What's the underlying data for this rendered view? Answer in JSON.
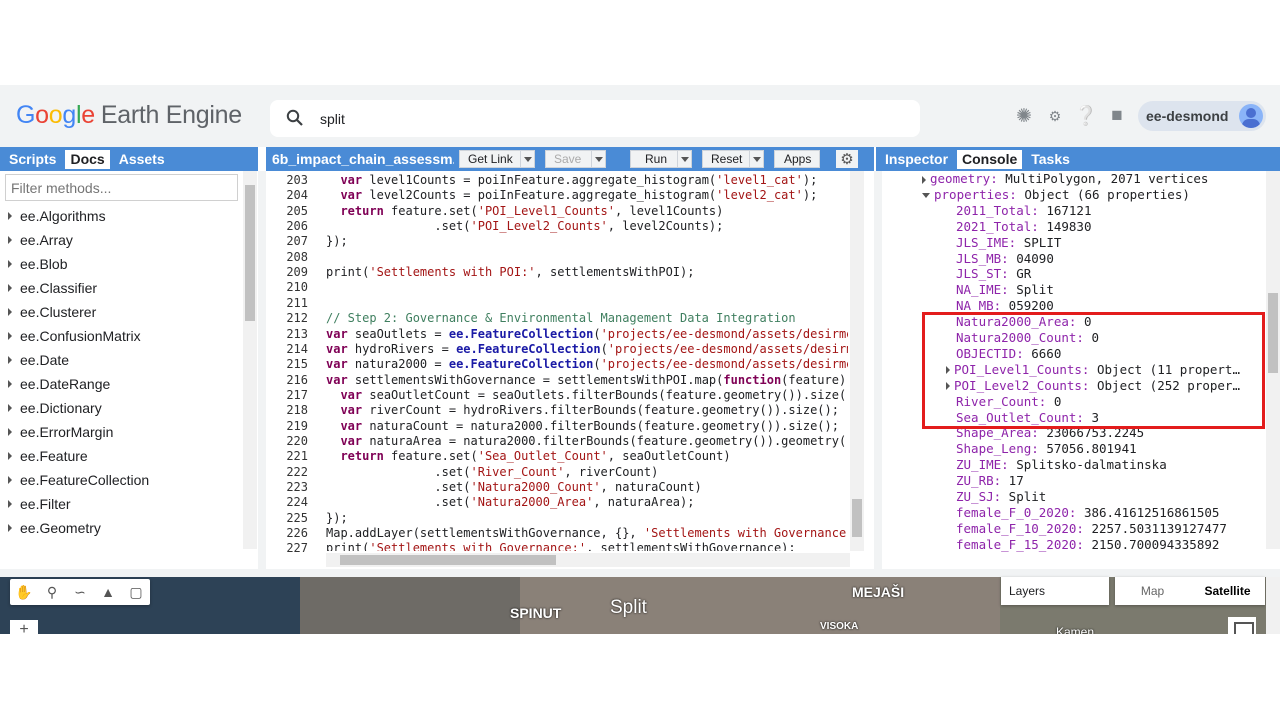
{
  "header": {
    "logo": {
      "g1": "G",
      "g2": "o",
      "g3": "o",
      "g4": "g",
      "g5": "l",
      "g6": "e",
      "rest": "Earth Engine"
    },
    "search_value": "split",
    "user": "ee-desmond",
    "icons": [
      "brightness-icon",
      "apps-icon",
      "help-icon",
      "feedback-icon"
    ]
  },
  "left_tabs": [
    "Scripts",
    "Docs",
    "Assets"
  ],
  "left_active": "Docs",
  "filter_placeholder": "Filter methods...",
  "doc_items": [
    "ee.Algorithms",
    "ee.Array",
    "ee.Blob",
    "ee.Classifier",
    "ee.Clusterer",
    "ee.ConfusionMatrix",
    "ee.Date",
    "ee.DateRange",
    "ee.Dictionary",
    "ee.ErrorMargin",
    "ee.Feature",
    "ee.FeatureCollection",
    "ee.Filter",
    "ee.Geometry"
  ],
  "editor": {
    "script_name": "6b_impact_chain_assessm...",
    "buttons": {
      "get_link": "Get Link",
      "save": "Save",
      "run": "Run",
      "reset": "Reset",
      "apps": "Apps"
    },
    "line_numbers": [
      "203",
      "204",
      "205",
      "206",
      "207",
      "208",
      "209",
      "210",
      "211",
      "212",
      "213",
      "214",
      "215",
      "216",
      "217",
      "218",
      "219",
      "220",
      "221",
      "222",
      "223",
      "224",
      "225",
      "226",
      "227"
    ],
    "lines": [
      "  var level1Counts = poiInFeature.aggregate_histogram('level1_cat');",
      "  var level2Counts = poiInFeature.aggregate_histogram('level2_cat');",
      "  return feature.set('POI_Level1_Counts', level1Counts)",
      "               .set('POI_Level2_Counts', level2Counts);",
      "});",
      "",
      "print('Settlements with POI:', settlementsWithPOI);",
      "",
      "",
      "// Step 2: Governance & Environmental Management Data Integration",
      "var seaOutlets = ee.FeatureCollection('projects/ee-desmond/assets/desirme",
      "var hydroRivers = ee.FeatureCollection('projects/ee-desmond/assets/desirm",
      "var natura2000 = ee.FeatureCollection('projects/ee-desmond/assets/desirme",
      "var settlementsWithGovernance = settlementsWithPOI.map(function(feature)",
      "  var seaOutletCount = seaOutlets.filterBounds(feature.geometry()).size()",
      "  var riverCount = hydroRivers.filterBounds(feature.geometry()).size();",
      "  var naturaCount = natura2000.filterBounds(feature.geometry()).size();",
      "  var naturaArea = natura2000.filterBounds(feature.geometry()).geometry()",
      "  return feature.set('Sea_Outlet_Count', seaOutletCount)",
      "               .set('River_Count', riverCount)",
      "               .set('Natura2000_Count', naturaCount)",
      "               .set('Natura2000_Area', naturaArea);",
      "});",
      "Map.addLayer(settlementsWithGovernance, {}, 'Settlements with Governance'",
      "print('Settlements with Governance:', settlementsWithGovernance);"
    ]
  },
  "right_tabs": [
    "Inspector",
    "Console",
    "Tasks"
  ],
  "right_active": "Console",
  "console": [
    {
      "indent": 0,
      "tri": "r",
      "key": "geometry:",
      "val": " MultiPolygon, 2071 vertices"
    },
    {
      "indent": 0,
      "tri": "d",
      "key": "properties:",
      "val": " Object (66 properties)"
    },
    {
      "indent": 1,
      "tri": "",
      "key": "2011_Total:",
      "val": " 167121"
    },
    {
      "indent": 1,
      "tri": "",
      "key": "2021_Total:",
      "val": " 149830"
    },
    {
      "indent": 1,
      "tri": "",
      "key": "JLS_IME:",
      "val": " SPLIT"
    },
    {
      "indent": 1,
      "tri": "",
      "key": "JLS_MB:",
      "val": " 04090"
    },
    {
      "indent": 1,
      "tri": "",
      "key": "JLS_ST:",
      "val": " GR"
    },
    {
      "indent": 1,
      "tri": "",
      "key": "NA_IME:",
      "val": " Split"
    },
    {
      "indent": 1,
      "tri": "",
      "key": "NA_MB:",
      "val": " 059200"
    },
    {
      "indent": 1,
      "tri": "",
      "key": "Natura2000_Area:",
      "val": " 0"
    },
    {
      "indent": 1,
      "tri": "",
      "key": "Natura2000_Count:",
      "val": " 0"
    },
    {
      "indent": 1,
      "tri": "",
      "key": "OBJECTID:",
      "val": " 6660"
    },
    {
      "indent": 1,
      "tri": "r",
      "key": "POI_Level1_Counts:",
      "val": " Object (11 propert…"
    },
    {
      "indent": 1,
      "tri": "r",
      "key": "POI_Level2_Counts:",
      "val": " Object (252 proper…"
    },
    {
      "indent": 1,
      "tri": "",
      "key": "River_Count:",
      "val": " 0"
    },
    {
      "indent": 1,
      "tri": "",
      "key": "Sea_Outlet_Count:",
      "val": " 3"
    },
    {
      "indent": 1,
      "tri": "",
      "key": "Shape_Area:",
      "val": " 23066753.2245"
    },
    {
      "indent": 1,
      "tri": "",
      "key": "Shape_Leng:",
      "val": " 57056.801941"
    },
    {
      "indent": 1,
      "tri": "",
      "key": "ZU_IME:",
      "val": " Splitsko-dalmatinska"
    },
    {
      "indent": 1,
      "tri": "",
      "key": "ZU_RB:",
      "val": " 17"
    },
    {
      "indent": 1,
      "tri": "",
      "key": "ZU_SJ:",
      "val": " Split"
    },
    {
      "indent": 1,
      "tri": "",
      "key": "female_F_0_2020:",
      "val": " 386.41612516861505"
    },
    {
      "indent": 1,
      "tri": "",
      "key": "female_F_10_2020:",
      "val": " 2257.5031139127477"
    },
    {
      "indent": 1,
      "tri": "",
      "key": "female_F_15_2020:",
      "val": " 2150.700094335892"
    }
  ],
  "map": {
    "labels": [
      "SPINUT",
      "Split",
      "MEJAŠI",
      "VISOKA",
      "Kamen"
    ],
    "layers_label": "Layers",
    "map_btn": "Map",
    "satellite_btn": "Satellite"
  },
  "colors": {
    "header_bg": "#f1f3f4",
    "tab_bar": "#4a8bd6",
    "highlight": "#e31c1c"
  }
}
